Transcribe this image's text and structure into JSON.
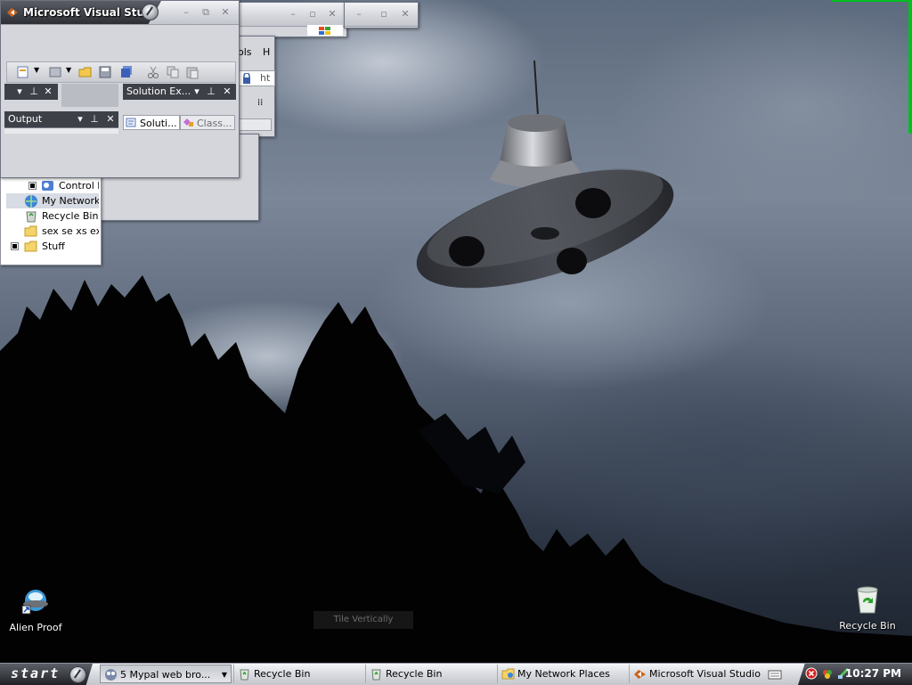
{
  "windows": {
    "vs_main": {
      "title": "Microsoft Visual Stu...",
      "panels": {
        "output": "Output",
        "solution_explorer": "Solution Ex...",
        "solution_tab": "Soluti...",
        "class_tab": "Class..."
      }
    },
    "browser": {
      "menu_partial_1": "ols",
      "menu_partial_2": "H",
      "address_partial": "ht"
    },
    "explorer": {
      "tree": [
        {
          "label": "Control P",
          "icon": "control-panel-icon",
          "expander": true
        },
        {
          "label": "My Network P",
          "icon": "network-places-icon",
          "expander": false
        },
        {
          "label": "Recycle Bin",
          "icon": "recycle-bin-icon",
          "expander": false
        },
        {
          "label": "sex se xs ex",
          "icon": "folder-icon",
          "expander": false
        },
        {
          "label": "Stuff",
          "icon": "folder-icon",
          "expander": true
        }
      ]
    }
  },
  "desktop": {
    "icons": [
      {
        "label": "Alien Proof",
        "icon": "alien-proof-icon"
      },
      {
        "label": "Recycle Bin",
        "icon": "recycle-bin-icon"
      }
    ],
    "ghost_label": "Tile Vertically"
  },
  "taskbar": {
    "start_label": "start",
    "tasks": [
      {
        "label": "5 Mypal web bro...",
        "icon": "mypal-browser-icon",
        "has_dropdown": true,
        "active": true
      },
      {
        "label": "Recycle Bin",
        "icon": "recycle-bin-icon"
      },
      {
        "label": "Recycle Bin",
        "icon": "recycle-bin-icon"
      },
      {
        "label": "My Network Places",
        "icon": "network-places-icon"
      },
      {
        "label": "Microsoft Visual Studio",
        "icon": "visual-studio-icon"
      }
    ],
    "clock": "10:27 PM"
  },
  "colors": {
    "accent_green": "#00c020",
    "title_tab": "#2e3036",
    "taskbar_light": "#d9dbe0"
  }
}
